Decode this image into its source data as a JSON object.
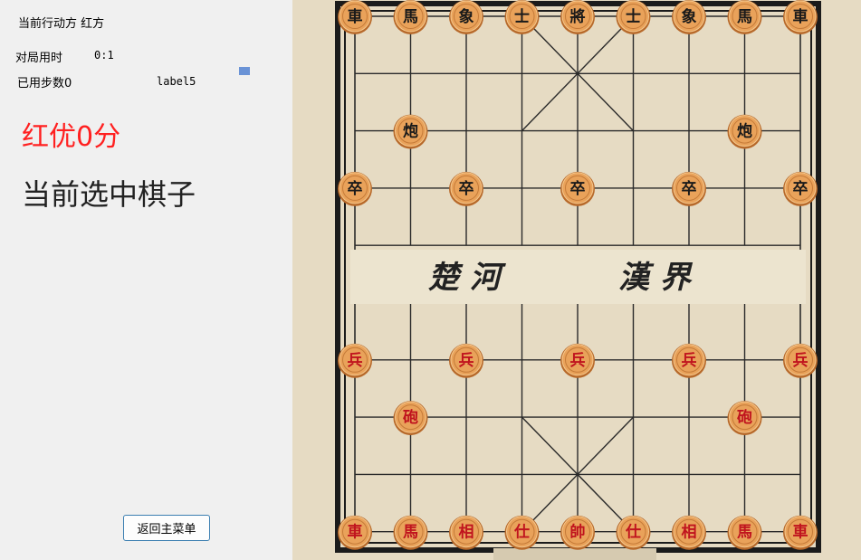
{
  "panel": {
    "turn_label": "当前行动方 红方",
    "time_caption": "对局用时",
    "time_value": "0:1",
    "steps_label": "已用步数0",
    "label5": "label5",
    "advantage": "红优0分",
    "selected_piece": "当前选中棋子",
    "back_button": "返回主菜单"
  },
  "colors": {
    "advantage_text": "#ff2020",
    "red_piece_text": "#c0141e",
    "black_piece_text": "#1a1a1a",
    "piece_face": "#e9a25a",
    "board_bg": "#e8dcc0"
  },
  "board": {
    "river_left": "楚 河",
    "river_right": "漢 界",
    "pieces": [
      {
        "c": "車",
        "side": "black",
        "col": 0,
        "row": 0
      },
      {
        "c": "馬",
        "side": "black",
        "col": 1,
        "row": 0
      },
      {
        "c": "象",
        "side": "black",
        "col": 2,
        "row": 0
      },
      {
        "c": "士",
        "side": "black",
        "col": 3,
        "row": 0
      },
      {
        "c": "將",
        "side": "black",
        "col": 4,
        "row": 0
      },
      {
        "c": "士",
        "side": "black",
        "col": 5,
        "row": 0
      },
      {
        "c": "象",
        "side": "black",
        "col": 6,
        "row": 0
      },
      {
        "c": "馬",
        "side": "black",
        "col": 7,
        "row": 0
      },
      {
        "c": "車",
        "side": "black",
        "col": 8,
        "row": 0
      },
      {
        "c": "炮",
        "side": "black",
        "col": 1,
        "row": 2
      },
      {
        "c": "炮",
        "side": "black",
        "col": 7,
        "row": 2
      },
      {
        "c": "卒",
        "side": "black",
        "col": 0,
        "row": 3
      },
      {
        "c": "卒",
        "side": "black",
        "col": 2,
        "row": 3
      },
      {
        "c": "卒",
        "side": "black",
        "col": 4,
        "row": 3
      },
      {
        "c": "卒",
        "side": "black",
        "col": 6,
        "row": 3
      },
      {
        "c": "卒",
        "side": "black",
        "col": 8,
        "row": 3
      },
      {
        "c": "兵",
        "side": "red",
        "col": 0,
        "row": 6
      },
      {
        "c": "兵",
        "side": "red",
        "col": 2,
        "row": 6
      },
      {
        "c": "兵",
        "side": "red",
        "col": 4,
        "row": 6
      },
      {
        "c": "兵",
        "side": "red",
        "col": 6,
        "row": 6
      },
      {
        "c": "兵",
        "side": "red",
        "col": 8,
        "row": 6
      },
      {
        "c": "砲",
        "side": "red",
        "col": 1,
        "row": 7
      },
      {
        "c": "砲",
        "side": "red",
        "col": 7,
        "row": 7
      },
      {
        "c": "車",
        "side": "red",
        "col": 0,
        "row": 9
      },
      {
        "c": "馬",
        "side": "red",
        "col": 1,
        "row": 9
      },
      {
        "c": "相",
        "side": "red",
        "col": 2,
        "row": 9
      },
      {
        "c": "仕",
        "side": "red",
        "col": 3,
        "row": 9
      },
      {
        "c": "帥",
        "side": "red",
        "col": 4,
        "row": 9
      },
      {
        "c": "仕",
        "side": "red",
        "col": 5,
        "row": 9
      },
      {
        "c": "相",
        "side": "red",
        "col": 6,
        "row": 9
      },
      {
        "c": "馬",
        "side": "red",
        "col": 7,
        "row": 9
      },
      {
        "c": "車",
        "side": "red",
        "col": 8,
        "row": 9
      }
    ]
  }
}
